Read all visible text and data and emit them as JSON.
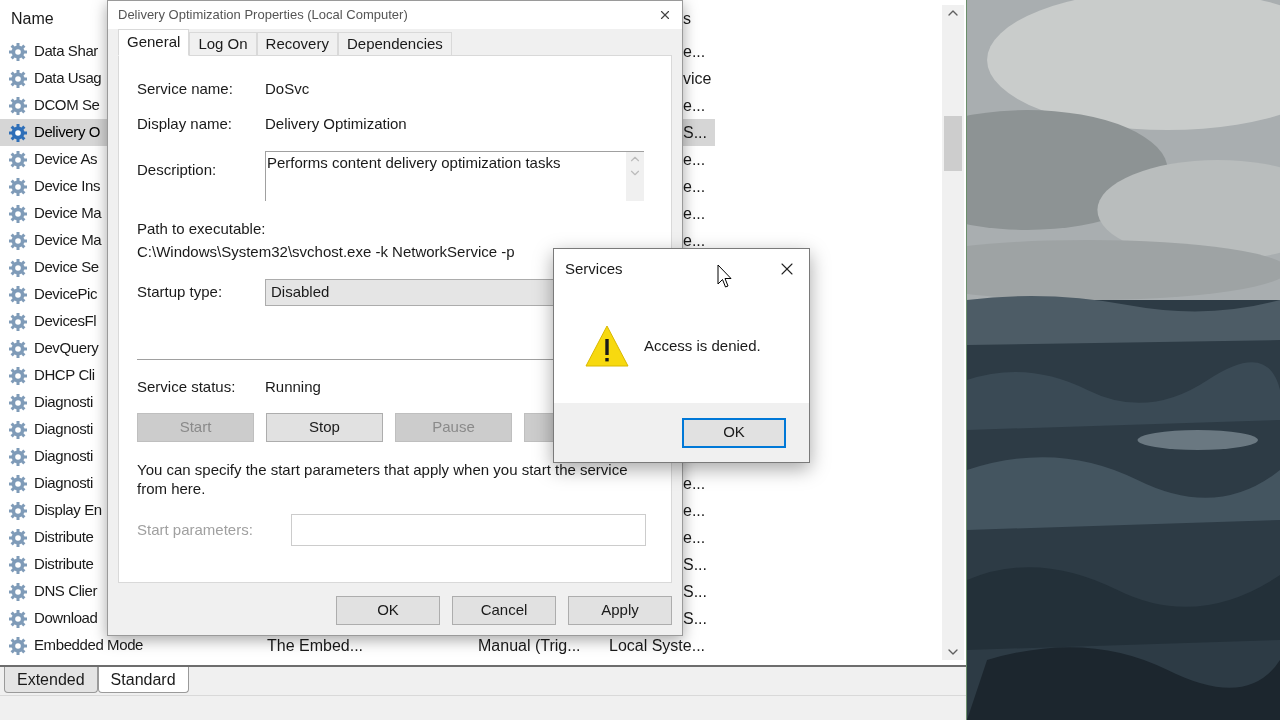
{
  "services_window": {
    "columns": [
      "Name",
      "s"
    ],
    "rows": [
      {
        "name": "Data Shar",
        "selected": false,
        "tail": "e..."
      },
      {
        "name": "Data Usag",
        "selected": false,
        "tail": "vice"
      },
      {
        "name": "DCOM Se",
        "selected": false,
        "tail": "e..."
      },
      {
        "name": "Delivery O",
        "selected": true,
        "tail": "S..."
      },
      {
        "name": "Device As",
        "selected": false,
        "tail": "e..."
      },
      {
        "name": "Device Ins",
        "selected": false,
        "tail": "e..."
      },
      {
        "name": "Device Ma",
        "selected": false,
        "tail": "e..."
      },
      {
        "name": "Device Ma",
        "selected": false,
        "tail": "e..."
      },
      {
        "name": "Device Se",
        "selected": false
      },
      {
        "name": "DevicePic",
        "selected": false
      },
      {
        "name": "DevicesFl",
        "selected": false
      },
      {
        "name": "DevQuery",
        "selected": false
      },
      {
        "name": "DHCP Cli",
        "selected": false
      },
      {
        "name": "Diagnosti",
        "selected": false
      },
      {
        "name": "Diagnosti",
        "selected": false
      },
      {
        "name": "Diagnosti",
        "selected": false
      },
      {
        "name": "Diagnosti",
        "selected": false,
        "tail": "e..."
      },
      {
        "name": "Display En",
        "selected": false,
        "tail": "e..."
      },
      {
        "name": "Distribute",
        "selected": false,
        "tail": "e..."
      },
      {
        "name": "Distribute",
        "selected": false,
        "tail": "S..."
      },
      {
        "name": "DNS Clier",
        "selected": false,
        "tail": "S..."
      },
      {
        "name": "Download",
        "selected": false,
        "tail": "S..."
      },
      {
        "name": "Embedded Mode",
        "selected": false,
        "cells": [
          "The Embed...",
          "Manual (Trig...",
          "Local Syste..."
        ]
      }
    ],
    "view_tabs": [
      {
        "label": "Extended",
        "selected": false
      },
      {
        "label": "Standard",
        "selected": true
      }
    ]
  },
  "properties_dialog": {
    "title": "Delivery Optimization Properties (Local Computer)",
    "tabs": [
      {
        "label": "General",
        "selected": true
      },
      {
        "label": "Log On",
        "selected": false
      },
      {
        "label": "Recovery",
        "selected": false
      },
      {
        "label": "Dependencies",
        "selected": false
      }
    ],
    "fields": [
      {
        "label": "Service name:",
        "value": "DoSvc"
      },
      {
        "label": "Display name:",
        "value": "Delivery Optimization"
      }
    ],
    "description": {
      "label": "Description:",
      "value": "Performs content delivery optimization tasks"
    },
    "path": {
      "label": "Path to executable:",
      "value": "C:\\Windows\\System32\\svchost.exe -k NetworkService -p"
    },
    "startup_type": {
      "label": "Startup type:",
      "value": "Disabled"
    },
    "service_status": {
      "label": "Service status:",
      "value": "Running"
    },
    "control_buttons": [
      {
        "label": "Start",
        "disabled": true
      },
      {
        "label": "Stop",
        "disabled": false
      },
      {
        "label": "Pause",
        "disabled": true
      },
      {
        "disabled": true
      }
    ],
    "hint": "You can specify the start parameters that apply when you start the service from here.",
    "start_parameters": {
      "label": "Start parameters:",
      "disabled": true
    },
    "buttons": [
      "OK",
      "Cancel",
      "Apply"
    ]
  },
  "message_box": {
    "title": "Services",
    "message": "Access is denied.",
    "buttons": [
      {
        "label": "OK",
        "default": true
      }
    ]
  }
}
